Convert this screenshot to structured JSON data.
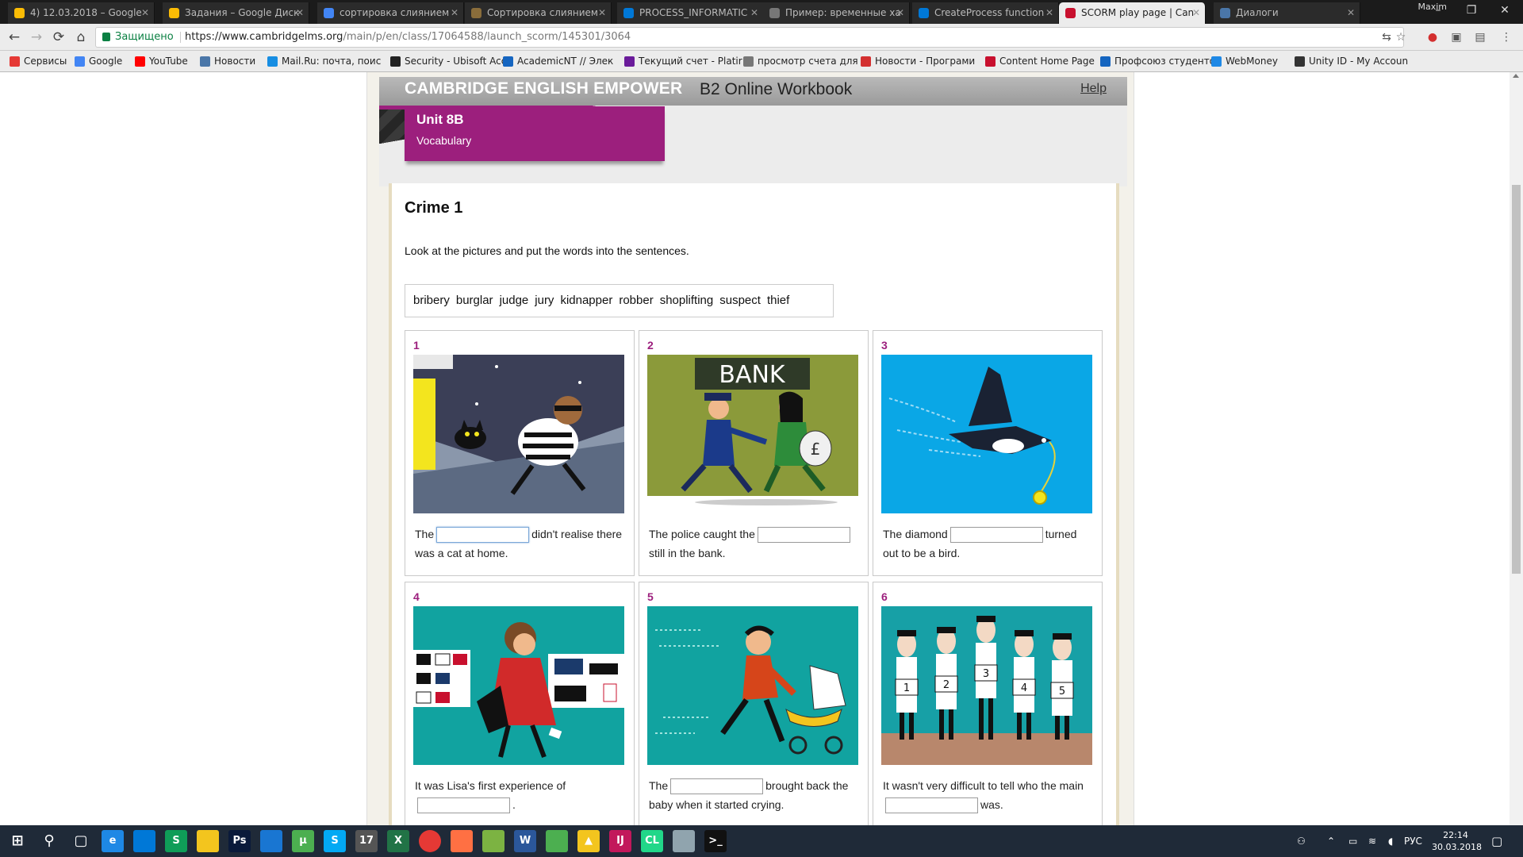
{
  "browser": {
    "tabs": [
      {
        "title": "4) 12.03.2018 – Google",
        "favicon": "google-drive-icon",
        "color": "#fbbc05"
      },
      {
        "title": "Задания – Google Диск",
        "favicon": "google-drive-icon",
        "color": "#fbbc05"
      },
      {
        "title": "сортировка слиянием",
        "favicon": "google-icon",
        "color": "#4285f4"
      },
      {
        "title": "Сортировка слиянием",
        "favicon": "site-icon",
        "color": "#8a6d3b"
      },
      {
        "title": "PROCESS_INFORMATIC",
        "favicon": "microsoft-icon",
        "color": "#0078d7"
      },
      {
        "title": "Пример: временные ха",
        "favicon": "page-icon",
        "color": "#777777"
      },
      {
        "title": "CreateProcess function",
        "favicon": "microsoft-icon",
        "color": "#0078d7"
      },
      {
        "title": "SCORM play page | Can",
        "favicon": "cambridge-icon",
        "color": "#c8102e"
      },
      {
        "title": "Диалоги",
        "favicon": "vk-icon",
        "color": "#4a76a8"
      }
    ],
    "active_tab_index": 7,
    "window_user": "Maxim",
    "secure_label": "Защищено",
    "url_prefix": "https://www.cambridgelms.org",
    "url_path": "/main/p/en/class/17064588/launch_scorm/145301/3064",
    "bookmarks": [
      {
        "label": "Сервисы",
        "icon": "apps-icon",
        "color": "#e53935"
      },
      {
        "label": "Google",
        "icon": "google-icon",
        "color": "#4285f4"
      },
      {
        "label": "YouTube",
        "icon": "youtube-icon",
        "color": "#ff0000"
      },
      {
        "label": "Новости",
        "icon": "vk-icon",
        "color": "#4a76a8"
      },
      {
        "label": "Mail.Ru: почта, поис",
        "icon": "mailru-icon",
        "color": "#168de2"
      },
      {
        "label": "Security - Ubisoft Acc",
        "icon": "ubisoft-icon",
        "color": "#222222"
      },
      {
        "label": "AcademicNT // Элек",
        "icon": "academic-icon",
        "color": "#1565c0"
      },
      {
        "label": "Текущий счет - Platir",
        "icon": "platinum-icon",
        "color": "#6a1b9a"
      },
      {
        "label": "просмотр счета для",
        "icon": "page-icon",
        "color": "#777777"
      },
      {
        "label": "Новости - Програми",
        "icon": "vtb-icon",
        "color": "#d32f2f"
      },
      {
        "label": "Content Home Page",
        "icon": "cambridge-icon",
        "color": "#c8102e"
      },
      {
        "label": "Профсоюз студенто",
        "icon": "union-icon",
        "color": "#1565c0"
      },
      {
        "label": "WebMoney",
        "icon": "webmoney-icon",
        "color": "#1e88e5"
      },
      {
        "label": "Unity ID - My Accoun",
        "icon": "unity-icon",
        "color": "#333333"
      }
    ]
  },
  "page": {
    "brand": "CAMBRIDGE ENGLISH EMPOWER",
    "product": "B2 Online Workbook",
    "help_label": "Help",
    "unit_title": "Unit 8B",
    "unit_subtitle": "Vocabulary",
    "exercise_title": "Crime 1",
    "instructions": "Look at the pictures and put the words into the sentences.",
    "word_bank": [
      "bribery",
      "burglar",
      "judge",
      "jury",
      "kidnapper",
      "robber",
      "shoplifting",
      "suspect",
      "thief"
    ],
    "accent_color": "#9c1f7d",
    "items": [
      {
        "number": "1",
        "before": "The",
        "after": "didn't realise there was a cat at home.",
        "answer": "",
        "picture": "burglar-cat-illustration"
      },
      {
        "number": "2",
        "before": "The police caught the",
        "after": "still in the bank.",
        "answer": "",
        "picture": "bank-robbery-illustration",
        "sign": "BANK"
      },
      {
        "number": "3",
        "before": "The diamond",
        "after": "turned out to be a bird.",
        "answer": "",
        "picture": "magpie-thief-illustration"
      },
      {
        "number": "4",
        "before": "It was Lisa's first experience of",
        "after": ".",
        "answer": "",
        "picture": "shoplifting-illustration"
      },
      {
        "number": "5",
        "before": "The",
        "after": "brought back the baby when it started crying.",
        "answer": "",
        "picture": "kidnapper-pram-illustration"
      },
      {
        "number": "6",
        "before": "It wasn't very difficult to tell who the main",
        "after": "was.",
        "answer": "",
        "picture": "police-lineup-illustration",
        "placards": [
          "1",
          "2",
          "3",
          "4",
          "5"
        ]
      }
    ]
  },
  "taskbar": {
    "apps": [
      {
        "name": "start-icon",
        "label": ""
      },
      {
        "name": "search-icon",
        "label": ""
      },
      {
        "name": "task-view-icon",
        "label": ""
      },
      {
        "name": "edge-icon",
        "label": "e"
      },
      {
        "name": "store-icon",
        "label": ""
      },
      {
        "name": "sheets-icon",
        "label": "S"
      },
      {
        "name": "file-explorer-icon",
        "label": ""
      },
      {
        "name": "photoshop-icon",
        "label": "Ps"
      },
      {
        "name": "dropbox-icon",
        "label": ""
      },
      {
        "name": "utorrent-icon",
        "label": "µ"
      },
      {
        "name": "skype-icon",
        "label": "S"
      },
      {
        "name": "calendar-icon",
        "label": "17"
      },
      {
        "name": "excel-icon",
        "label": "X"
      },
      {
        "name": "chrome-icon",
        "label": ""
      },
      {
        "name": "firefox-icon",
        "label": ""
      },
      {
        "name": "notepad-icon",
        "label": ""
      },
      {
        "name": "word-icon",
        "label": "W"
      },
      {
        "name": "xbox-icon",
        "label": ""
      },
      {
        "name": "unity-hub-icon",
        "label": "▲"
      },
      {
        "name": "intellij-icon",
        "label": "IJ"
      },
      {
        "name": "clion-icon",
        "label": "CL"
      },
      {
        "name": "wizard-icon",
        "label": ""
      },
      {
        "name": "terminal-icon",
        "label": ">_"
      }
    ],
    "language": "РУС",
    "time": "22:14",
    "date": "30.03.2018"
  }
}
